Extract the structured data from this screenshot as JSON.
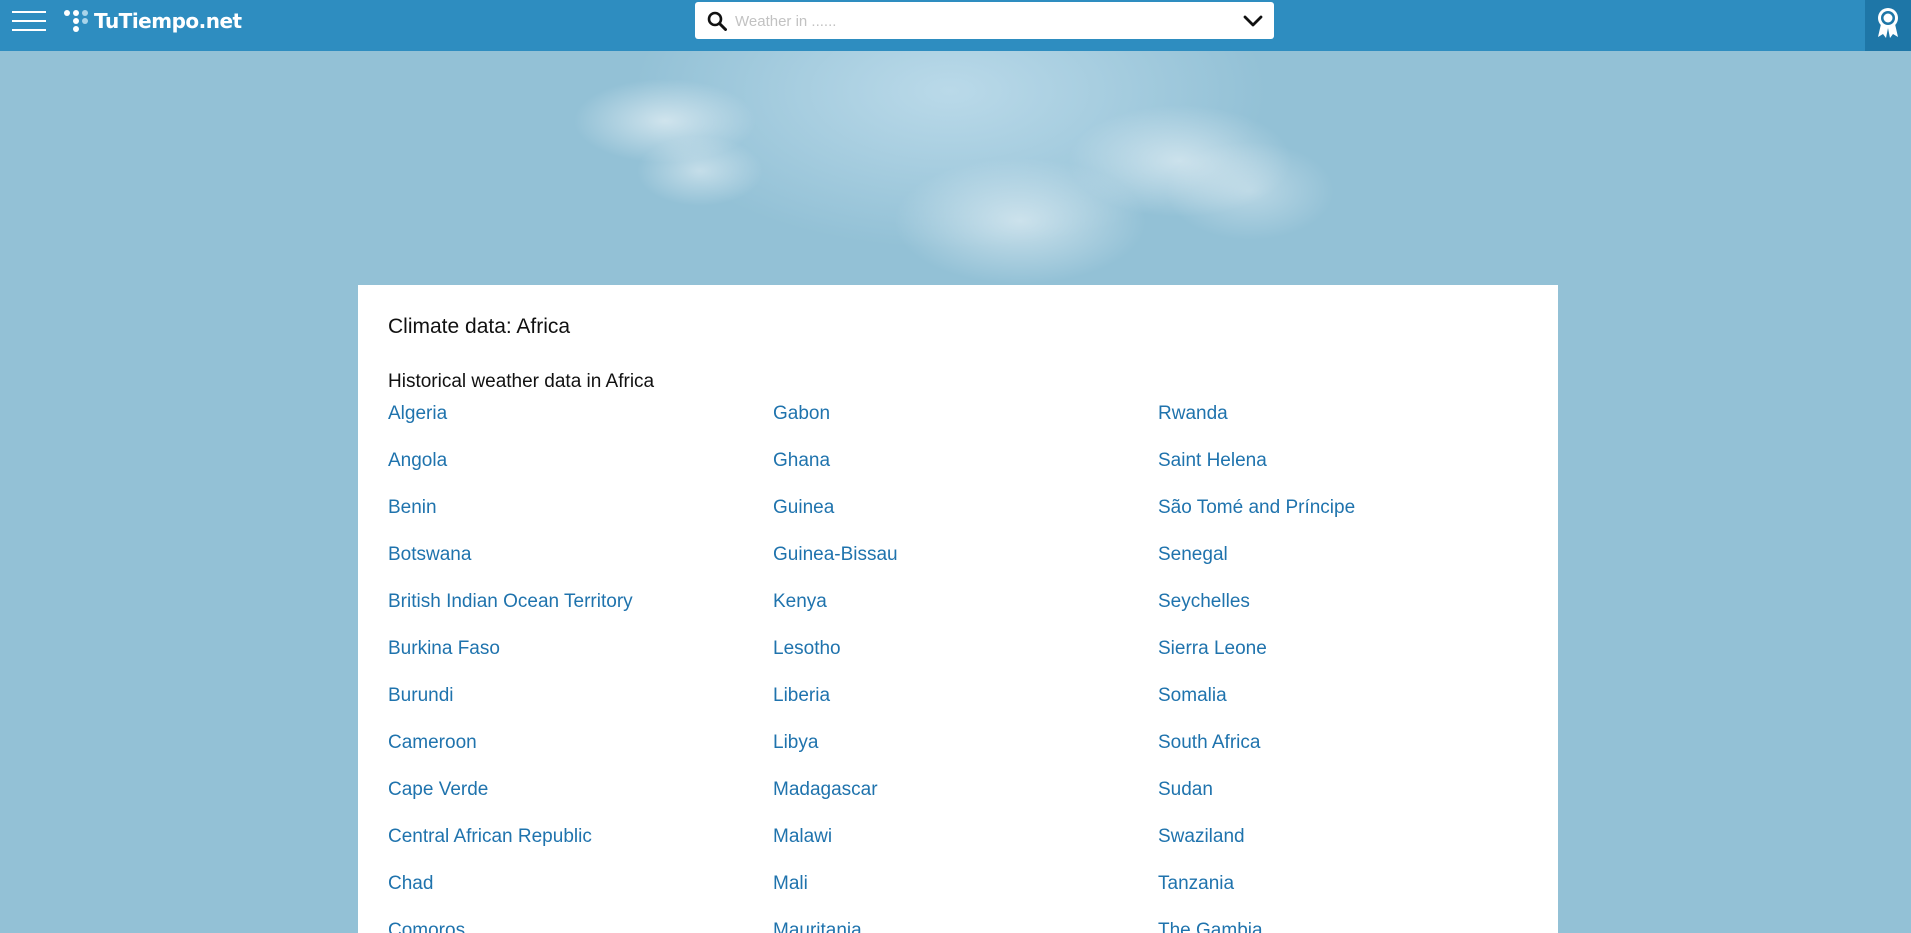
{
  "header": {
    "logo_text": "TuTiempo.net",
    "menu_icon": "hamburger-icon",
    "award_icon": "award-ribbon-icon",
    "brand_color": "#2e8dc0"
  },
  "search": {
    "placeholder": "Weather in ......",
    "value": "",
    "icon": "search-icon",
    "dropdown_icon": "chevron-down-icon"
  },
  "main": {
    "title": "Climate data: Africa",
    "subtitle": "Historical weather data in Africa",
    "link_color": "#1f73ad",
    "countries": [
      "Algeria",
      "Angola",
      "Benin",
      "Botswana",
      "British Indian Ocean Territory",
      "Burkina Faso",
      "Burundi",
      "Cameroon",
      "Cape Verde",
      "Central African Republic",
      "Chad",
      "Comoros",
      "Gabon",
      "Ghana",
      "Guinea",
      "Guinea-Bissau",
      "Kenya",
      "Lesotho",
      "Liberia",
      "Libya",
      "Madagascar",
      "Malawi",
      "Mali",
      "Mauritania",
      "Rwanda",
      "Saint Helena",
      "São Tomé and Príncipe",
      "Senegal",
      "Seychelles",
      "Sierra Leone",
      "Somalia",
      "South Africa",
      "Sudan",
      "Swaziland",
      "Tanzania",
      "The Gambia"
    ]
  }
}
